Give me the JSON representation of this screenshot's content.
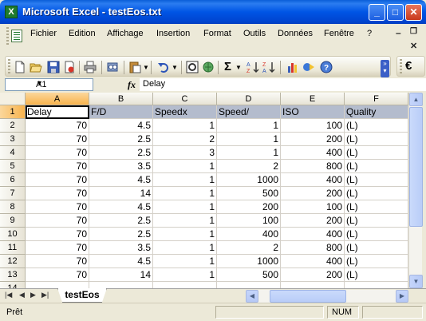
{
  "window": {
    "title": "Microsoft Excel - testEos.txt",
    "app_icon": "excel-icon",
    "minimize_label": "_",
    "maximize_label": "□",
    "close_label": "✕"
  },
  "menu": {
    "items": [
      "Fichier",
      "Edition",
      "Affichage",
      "Insertion",
      "Format",
      "Outils",
      "Données",
      "Fenêtre",
      "?"
    ],
    "doc_min": "–",
    "doc_restore": "❐",
    "doc_close": "✕"
  },
  "toolbar": {
    "icons": [
      "new-icon",
      "open-icon",
      "save-icon",
      "permission-icon",
      "print-icon",
      "print-preview-icon",
      "research-icon",
      "paste-icon",
      "undo-icon",
      "chart-wizard-icon",
      "hyperlink-icon",
      "autosum-icon",
      "sort-ascending-icon",
      "sort-descending-icon",
      "chart-icon",
      "drawing-icon",
      "help-icon",
      "euro-icon"
    ],
    "autosum_glyph": "Σ",
    "euro_glyph": "€"
  },
  "formula_bar": {
    "name_box": "A1",
    "fx_label": "fx",
    "value": "Delay"
  },
  "sheet": {
    "columns": [
      "A",
      "B",
      "C",
      "D",
      "E",
      "F"
    ],
    "row_numbers": [
      "1",
      "2",
      "3",
      "4",
      "5",
      "6",
      "7",
      "8",
      "9",
      "10",
      "11",
      "12",
      "13",
      "14"
    ],
    "header": [
      "Delay",
      "F/D",
      "Speedx",
      "Speed/",
      "ISO",
      "Quality"
    ],
    "rows": [
      [
        "70",
        "4.5",
        "1",
        "1",
        "100",
        "(L)"
      ],
      [
        "70",
        "2.5",
        "2",
        "1",
        "200",
        "(L)"
      ],
      [
        "70",
        "2.5",
        "3",
        "1",
        "400",
        "(L)"
      ],
      [
        "70",
        "3.5",
        "1",
        "2",
        "800",
        "(L)"
      ],
      [
        "70",
        "4.5",
        "1",
        "1000",
        "400",
        "(L)"
      ],
      [
        "70",
        "14",
        "1",
        "500",
        "200",
        "(L)"
      ],
      [
        "70",
        "4.5",
        "1",
        "200",
        "100",
        "(L)"
      ],
      [
        "70",
        "2.5",
        "1",
        "100",
        "200",
        "(L)"
      ],
      [
        "70",
        "2.5",
        "1",
        "400",
        "400",
        "(L)"
      ],
      [
        "70",
        "3.5",
        "1",
        "2",
        "800",
        "(L)"
      ],
      [
        "70",
        "4.5",
        "1",
        "1000",
        "400",
        "(L)"
      ],
      [
        "70",
        "14",
        "1",
        "500",
        "200",
        "(L)"
      ]
    ],
    "active_cell": "A1"
  },
  "tabs": {
    "sheet_name": "testEos",
    "nav": [
      "|◀",
      "◀",
      "▶",
      "▶|"
    ]
  },
  "status": {
    "text": "Prêt",
    "num": "NUM"
  }
}
